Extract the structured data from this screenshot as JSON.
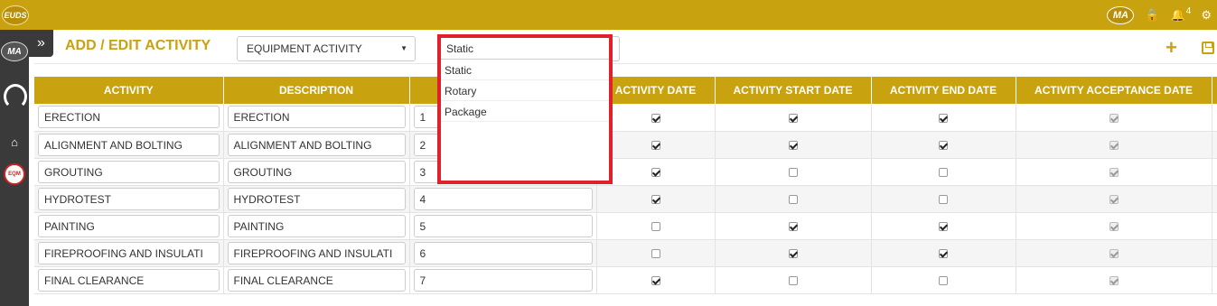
{
  "brand": {
    "logo_text": "EUDS"
  },
  "topbar": {
    "user_badge": "MA",
    "notification_count": "4"
  },
  "sidebar": {
    "user_badge": "MA",
    "module_badge": "EQM"
  },
  "header": {
    "title": "ADD / EDIT ACTIVITY",
    "activity_type": "EQUIPMENT ACTIVITY"
  },
  "dropdown": {
    "current": "Static",
    "options": [
      "Static",
      "Rotary",
      "Package"
    ]
  },
  "table": {
    "columns": [
      "ACTIVITY",
      "DESCRIPTION",
      "",
      "ACTIVITY DATE",
      "ACTIVITY START DATE",
      "ACTIVITY END DATE",
      "ACTIVITY ACCEPTANCE DATE"
    ],
    "rows": [
      {
        "activity": "ERECTION",
        "description": "ERECTION",
        "order": "1",
        "date": true,
        "start": true,
        "end": true,
        "accept": true
      },
      {
        "activity": "ALIGNMENT AND BOLTING",
        "description": "ALIGNMENT AND BOLTING",
        "order": "2",
        "date": true,
        "start": true,
        "end": true,
        "accept": true
      },
      {
        "activity": "GROUTING",
        "description": "GROUTING",
        "order": "3",
        "date": true,
        "start": false,
        "end": false,
        "accept": true
      },
      {
        "activity": "HYDROTEST",
        "description": "HYDROTEST",
        "order": "4",
        "date": true,
        "start": false,
        "end": false,
        "accept": true
      },
      {
        "activity": "PAINTING",
        "description": "PAINTING",
        "order": "5",
        "date": false,
        "start": true,
        "end": true,
        "accept": true
      },
      {
        "activity": "FIREPROOFING AND INSULATI",
        "description": "FIREPROOFING AND INSULATI",
        "order": "6",
        "date": false,
        "start": true,
        "end": true,
        "accept": true
      },
      {
        "activity": "FINAL CLEARANCE",
        "description": "FINAL CLEARANCE",
        "order": "7",
        "date": true,
        "start": false,
        "end": false,
        "accept": true
      }
    ]
  }
}
